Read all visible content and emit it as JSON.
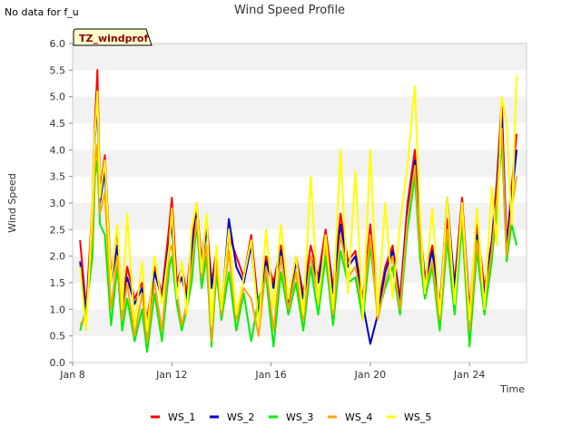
{
  "note": "No data for f_u",
  "site_badge": "TZ_windprof",
  "colors": {
    "WS_1": "#ff0000",
    "WS_2": "#0000cc",
    "WS_3": "#00ee00",
    "WS_4": "#ffa500",
    "WS_5": "#ffff00",
    "band": "#f2f2f2",
    "badge_fill": "#ffffcc",
    "badge_text": "#8b0000"
  },
  "chart_data": {
    "type": "line",
    "title": "Wind Speed Profile",
    "xlabel": "Time",
    "ylabel": "Wind Speed",
    "x_unit": "days since Jan 8",
    "xlim": [
      0,
      18.3
    ],
    "ylim": [
      0.0,
      6.0
    ],
    "yticks": [
      "0.0",
      "0.5",
      "1.0",
      "1.5",
      "2.0",
      "2.5",
      "3.0",
      "3.5",
      "4.0",
      "4.5",
      "5.0",
      "5.5",
      "6.0"
    ],
    "xticks": [
      {
        "value": 0,
        "label": "Jan 8"
      },
      {
        "value": 4,
        "label": "Jan 12"
      },
      {
        "value": 8,
        "label": "Jan 16"
      },
      {
        "value": 12,
        "label": "Jan 20"
      },
      {
        "value": 16,
        "label": "Jan 24"
      }
    ],
    "grid": "horizontal bands",
    "legend_position": "bottom",
    "x": [
      0.3,
      0.55,
      0.8,
      0.9,
      1.0,
      1.1,
      1.3,
      1.55,
      1.8,
      2.0,
      2.2,
      2.5,
      2.8,
      3.0,
      3.3,
      3.6,
      3.9,
      4.0,
      4.2,
      4.4,
      4.6,
      4.8,
      5.0,
      5.2,
      5.4,
      5.6,
      5.8,
      6.0,
      6.3,
      6.6,
      6.9,
      7.2,
      7.5,
      7.8,
      8.1,
      8.4,
      8.7,
      9.0,
      9.3,
      9.6,
      9.9,
      10.2,
      10.5,
      10.8,
      11.1,
      11.4,
      11.7,
      12.0,
      12.3,
      12.6,
      12.9,
      13.2,
      13.5,
      13.8,
      14.0,
      14.2,
      14.5,
      14.8,
      15.1,
      15.4,
      15.7,
      16.0,
      16.3,
      16.6,
      16.9,
      17.1,
      17.3,
      17.5,
      17.7,
      17.9
    ],
    "series": [
      {
        "name": "WS_1",
        "values": [
          2.3,
          1.0,
          3.0,
          4.5,
          5.5,
          3.2,
          3.9,
          1.6,
          2.5,
          1.0,
          1.8,
          1.2,
          1.5,
          0.8,
          1.8,
          1.3,
          2.6,
          3.1,
          1.5,
          1.8,
          1.3,
          2.3,
          3.0,
          1.9,
          2.7,
          1.5,
          2.1,
          1.0,
          2.4,
          2.0,
          1.6,
          2.4,
          1.0,
          2.0,
          1.5,
          2.2,
          1.1,
          2.0,
          1.3,
          2.2,
          1.6,
          2.5,
          1.4,
          2.8,
          1.9,
          2.1,
          1.2,
          2.6,
          1.0,
          1.8,
          2.2,
          1.2,
          3.0,
          4.0,
          2.6,
          1.6,
          2.2,
          1.1,
          2.7,
          1.5,
          3.1,
          1.0,
          2.6,
          1.4,
          2.3,
          3.4,
          4.9,
          2.2,
          3.3,
          4.3
        ]
      },
      {
        "name": "WS_2",
        "values": [
          1.9,
          0.9,
          2.8,
          4.2,
          4.9,
          3.0,
          3.6,
          1.5,
          2.2,
          0.9,
          1.6,
          1.1,
          1.4,
          0.7,
          1.7,
          1.2,
          2.3,
          2.6,
          1.4,
          1.6,
          1.2,
          2.1,
          2.8,
          1.8,
          2.5,
          1.4,
          2.0,
          0.9,
          2.7,
          1.8,
          1.5,
          2.2,
          0.9,
          1.9,
          1.4,
          2.1,
          1.0,
          1.9,
          1.2,
          2.0,
          1.5,
          2.3,
          1.3,
          2.6,
          1.8,
          2.0,
          1.1,
          0.35,
          0.9,
          1.7,
          2.1,
          1.1,
          2.8,
          3.8,
          2.5,
          1.5,
          2.1,
          1.0,
          3.1,
          1.4,
          2.9,
          0.9,
          2.4,
          1.3,
          2.2,
          3.2,
          4.6,
          2.1,
          3.1,
          4.0
        ]
      },
      {
        "name": "WS_3",
        "values": [
          0.6,
          1.0,
          2.0,
          3.5,
          3.8,
          2.6,
          2.4,
          0.7,
          1.8,
          0.6,
          1.2,
          0.4,
          1.0,
          0.2,
          1.3,
          0.4,
          1.8,
          2.0,
          1.1,
          0.6,
          1.0,
          1.5,
          2.6,
          1.4,
          2.0,
          0.3,
          1.7,
          0.8,
          1.7,
          0.6,
          1.3,
          0.4,
          1.2,
          1.6,
          0.3,
          1.7,
          0.9,
          1.5,
          0.6,
          1.8,
          0.9,
          2.0,
          0.7,
          2.1,
          1.5,
          1.6,
          0.8,
          2.2,
          0.9,
          1.4,
          1.8,
          0.9,
          2.5,
          3.5,
          2.0,
          1.2,
          1.8,
          0.6,
          2.3,
          0.9,
          2.6,
          0.3,
          2.1,
          0.9,
          1.9,
          2.9,
          4.2,
          1.9,
          2.6,
          2.2
        ]
      },
      {
        "name": "WS_4",
        "values": [
          0.7,
          0.9,
          2.4,
          3.7,
          4.1,
          2.8,
          3.2,
          1.0,
          2.0,
          0.8,
          1.5,
          0.5,
          1.3,
          0.4,
          1.5,
          0.6,
          2.1,
          2.2,
          1.3,
          0.7,
          1.1,
          1.8,
          2.7,
          1.6,
          2.2,
          0.4,
          1.9,
          0.9,
          2.1,
          0.8,
          1.4,
          1.2,
          0.5,
          1.8,
          0.6,
          2.0,
          1.0,
          1.7,
          0.8,
          2.0,
          1.2,
          2.2,
          0.9,
          2.4,
          1.6,
          1.8,
          1.0,
          2.4,
          0.8,
          1.5,
          2.0,
          1.0,
          2.7,
          3.7,
          2.2,
          1.4,
          1.9,
          0.8,
          2.5,
          1.2,
          2.8,
          0.6,
          2.3,
          1.1,
          2.1,
          3.1,
          4.4,
          2.0,
          2.9,
          3.5
        ]
      },
      {
        "name": "WS_5",
        "values": [
          1.8,
          0.6,
          3.0,
          4.3,
          5.1,
          3.1,
          3.8,
          1.5,
          2.6,
          1.0,
          2.8,
          0.7,
          1.9,
          0.6,
          2.0,
          1.1,
          2.2,
          2.9,
          1.2,
          1.9,
          0.9,
          2.5,
          3.0,
          1.7,
          2.8,
          0.7,
          2.2,
          1.0,
          2.5,
          0.9,
          1.6,
          2.3,
          0.7,
          2.5,
          1.0,
          2.6,
          1.2,
          2.0,
          0.9,
          3.5,
          1.1,
          2.4,
          1.0,
          4.0,
          1.3,
          3.6,
          0.8,
          4.0,
          0.9,
          3.0,
          1.2,
          2.6,
          3.7,
          5.2,
          2.8,
          1.3,
          2.9,
          0.9,
          3.1,
          1.1,
          3.0,
          0.8,
          2.9,
          1.0,
          3.3,
          2.2,
          5.0,
          4.5,
          2.6,
          5.4
        ]
      }
    ]
  },
  "legend": [
    {
      "key": "WS_1",
      "label": "WS_1"
    },
    {
      "key": "WS_2",
      "label": "WS_2"
    },
    {
      "key": "WS_3",
      "label": "WS_3"
    },
    {
      "key": "WS_4",
      "label": "WS_4"
    },
    {
      "key": "WS_5",
      "label": "WS_5"
    }
  ]
}
